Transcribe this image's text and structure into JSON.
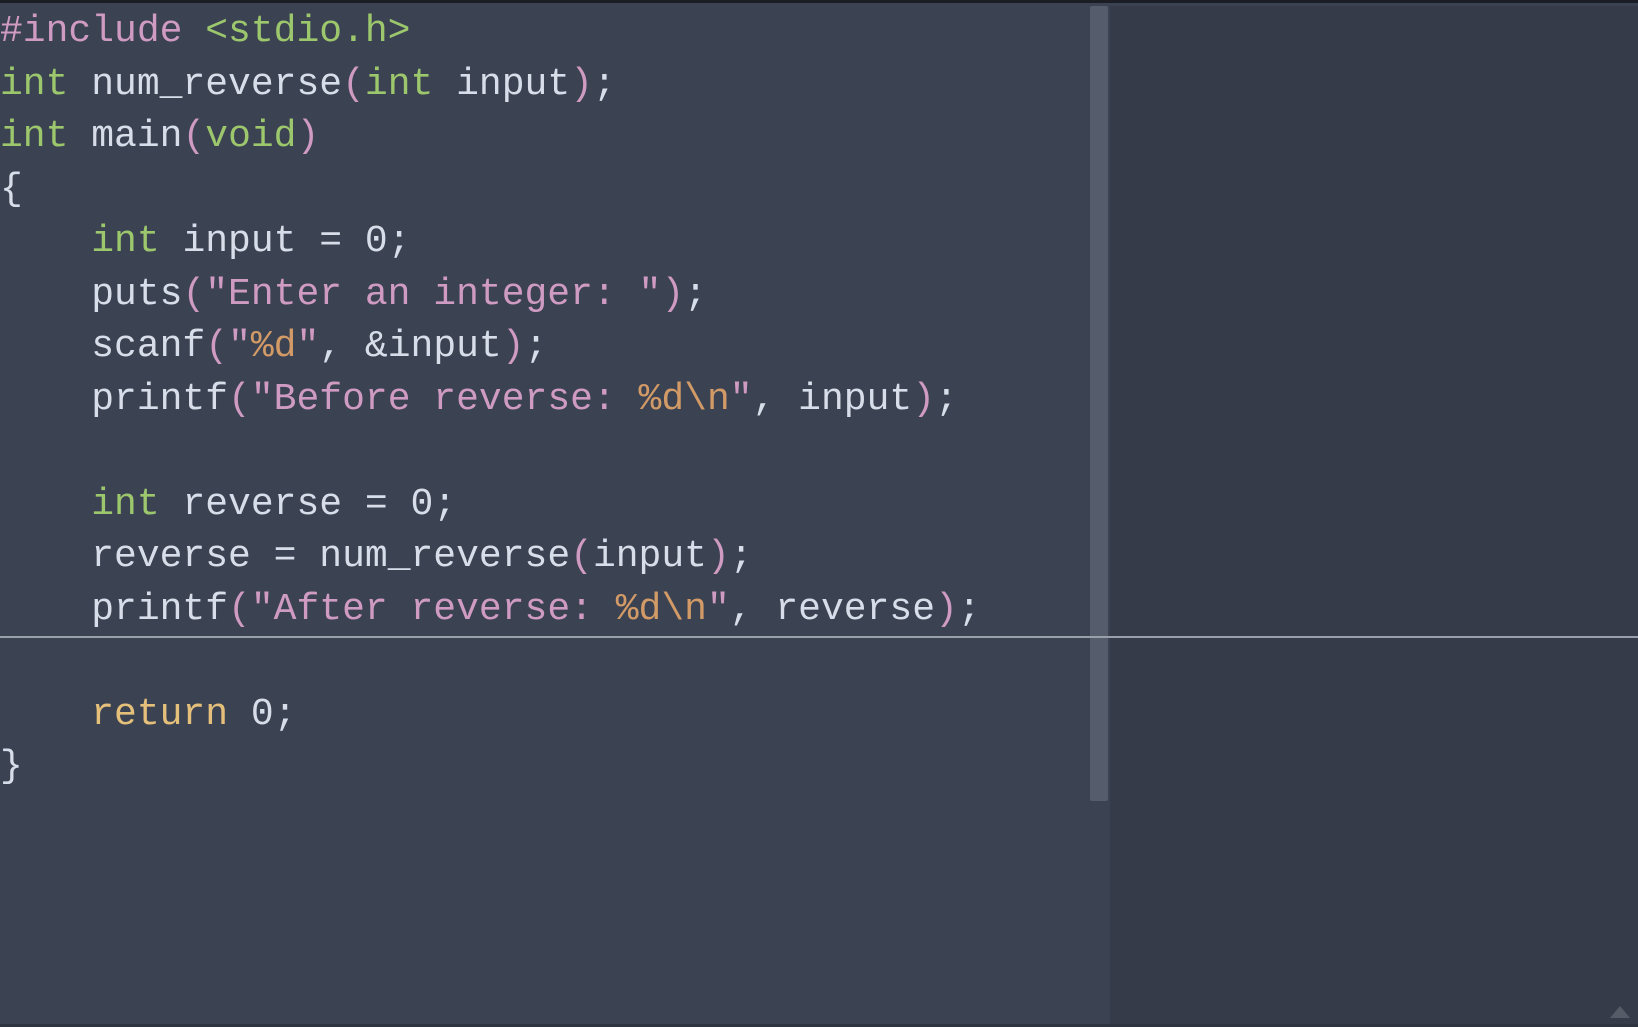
{
  "code": {
    "line1": {
      "hash_include": "#include ",
      "path": "<stdio.h>"
    },
    "line2": {
      "type1": "int",
      "space1": " ",
      "func": "num_reverse",
      "lparen": "(",
      "type2": "int",
      "space2": " ",
      "param": "input",
      "rparen": ")",
      "semi": ";"
    },
    "line3": {
      "type1": "int",
      "space1": " ",
      "func": "main",
      "lparen": "(",
      "void": "void",
      "rparen": ")"
    },
    "line4": {
      "brace": "{"
    },
    "line5": {
      "indent": "    ",
      "type": "int",
      "space": " ",
      "var": "input ",
      "op": "=",
      "space2": " ",
      "num": "0",
      "semi": ";"
    },
    "line6": {
      "indent": "    ",
      "func": "puts",
      "lparen": "(",
      "str": "\"Enter an integer: \"",
      "rparen": ")",
      "semi": ";"
    },
    "line7": {
      "indent": "    ",
      "func": "scanf",
      "lparen": "(",
      "q1": "\"",
      "fmt": "%d",
      "q2": "\"",
      "comma": ", ",
      "amp": "&",
      "var": "input",
      "rparen": ")",
      "semi": ";"
    },
    "line8": {
      "indent": "    ",
      "func": "printf",
      "lparen": "(",
      "q1": "\"",
      "str1": "Before reverse: ",
      "fmt": "%d",
      "esc": "\\n",
      "q2": "\"",
      "comma": ", ",
      "var": "input",
      "rparen": ")",
      "semi": ";"
    },
    "line9": "",
    "line10": {
      "indent": "    ",
      "type": "int",
      "space": " ",
      "var": "reverse ",
      "op": "=",
      "space2": " ",
      "num": "0",
      "semi": ";"
    },
    "line11": {
      "indent": "    ",
      "var1": "reverse ",
      "op": "=",
      "space": " ",
      "func": "num_reverse",
      "lparen": "(",
      "arg": "input",
      "rparen": ")",
      "semi": ";"
    },
    "line12": {
      "indent": "    ",
      "func": "printf",
      "lparen": "(",
      "q1": "\"",
      "str1": "After reverse: ",
      "fmt": "%d",
      "esc": "\\n",
      "q2": "\"",
      "comma": ", ",
      "var": "reverse",
      "rparen": ")",
      "semi": ";"
    },
    "line13": "",
    "line14": {
      "indent": "    ",
      "ret": "return",
      "space": " ",
      "num": "0",
      "semi": ";"
    },
    "line15": {
      "brace": "}"
    }
  }
}
